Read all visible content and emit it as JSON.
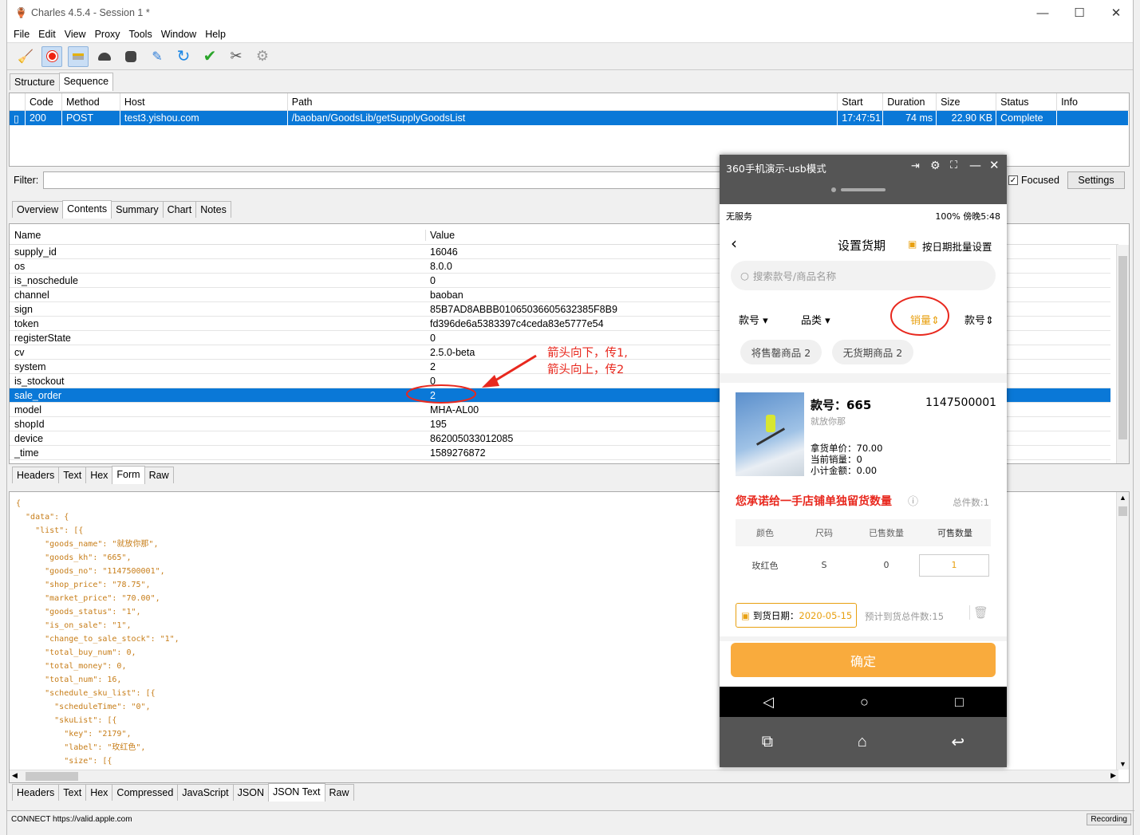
{
  "window": {
    "title": "Charles 4.5.4 - Session 1 *"
  },
  "menu": [
    "File",
    "Edit",
    "View",
    "Proxy",
    "Tools",
    "Window",
    "Help"
  ],
  "top_tabs": [
    "Structure",
    "Sequence"
  ],
  "seq_headers": [
    "Code",
    "Method",
    "Host",
    "Path",
    "Start",
    "Duration",
    "Size",
    "Status",
    "Info"
  ],
  "seq_row": {
    "code": "200",
    "method": "POST",
    "host": "test3.yishou.com",
    "path": "/baoban/GoodsLib/getSupplyGoodsList",
    "start": "17:47:51",
    "duration": "74 ms",
    "size": "22.90 KB",
    "status": "Complete",
    "info": ""
  },
  "filter": {
    "label": "Filter:",
    "focused": "Focused",
    "settings": "Settings"
  },
  "detail_tabs": [
    "Overview",
    "Contents",
    "Summary",
    "Chart",
    "Notes"
  ],
  "kv_headers": {
    "name": "Name",
    "value": "Value"
  },
  "kv_rows": [
    {
      "k": "supply_id",
      "v": "16046"
    },
    {
      "k": "os",
      "v": "8.0.0"
    },
    {
      "k": "is_noschedule",
      "v": "0"
    },
    {
      "k": "channel",
      "v": "baoban"
    },
    {
      "k": "sign",
      "v": "85B7AD8ABBB01065036605632385F8B9"
    },
    {
      "k": "token",
      "v": "fd396de6a5383397c4ceda83e5777e54"
    },
    {
      "k": "registerState",
      "v": "0"
    },
    {
      "k": "cv",
      "v": "2.5.0-beta"
    },
    {
      "k": "system",
      "v": "2"
    },
    {
      "k": "is_stockout",
      "v": "0"
    },
    {
      "k": "sale_order",
      "v": "2"
    },
    {
      "k": "model",
      "v": "MHA-AL00"
    },
    {
      "k": "shopId",
      "v": "195"
    },
    {
      "k": "device",
      "v": "862005033012085"
    },
    {
      "k": "_time",
      "v": "1589276872"
    }
  ],
  "annotation": {
    "line1": "箭头向下，传1,",
    "line2": "箭头向上，传2"
  },
  "req_tabs": [
    "Headers",
    "Text",
    "Hex",
    "Form",
    "Raw"
  ],
  "json_lines": [
    "{",
    "  \"data\": {",
    "    \"list\": [{",
    "      \"goods_name\": \"就放你那\",",
    "      \"goods_kh\": \"665\",",
    "      \"goods_no\": \"1147500001\",",
    "      \"shop_price\": \"78.75\",",
    "      \"market_price\": \"70.00\",",
    "      \"goods_status\": \"1\",",
    "      \"is_on_sale\": \"1\",",
    "      \"change_to_sale_stock\": \"1\",",
    "      \"total_buy_num\": 0,",
    "      \"total_money\": 0,",
    "      \"total_num\": 16,",
    "      \"schedule_sku_list\": [{",
    "        \"scheduleTime\": \"0\",",
    "        \"skuList\": [{",
    "          \"key\": \"2179\",",
    "          \"label\": \"玫红色\",",
    "          \"size\": [{"
  ],
  "resp_tabs": [
    "Headers",
    "Text",
    "Hex",
    "Compressed",
    "JavaScript",
    "JSON",
    "JSON Text",
    "Raw"
  ],
  "statusbar": {
    "left": "CONNECT https://valid.apple.com",
    "right": "Recording"
  },
  "phone": {
    "title": "360手机演示-usb模式",
    "status_left": "无服务",
    "status_right": "100%  傍晚5:48",
    "page_title": "设置货期",
    "batch": "按日期批量设置",
    "search_placeholder": "搜索款号/商品名称",
    "sort": [
      "款号",
      "品类",
      "销量",
      "款号"
    ],
    "chips": [
      "将售罄商品 2",
      "无货期商品 2"
    ],
    "item": {
      "kh": "款号：665",
      "no": "1147500001",
      "name": "就放你那",
      "price": "拿货单价：70.00",
      "sales": "当前销量：0",
      "subtotal": "小计金额：0.00"
    },
    "promise": "您承诺给一手店铺单独留货数量",
    "total": "总件数:1",
    "table_headers": [
      "颜色",
      "尺码",
      "已售数量",
      "可售数量"
    ],
    "table_row": [
      "玫红色",
      "S",
      "0",
      "1"
    ],
    "date_label": "到货日期：",
    "date_value": "2020-05-15",
    "expected": "预计到货总件数:15",
    "confirm": "确定"
  }
}
